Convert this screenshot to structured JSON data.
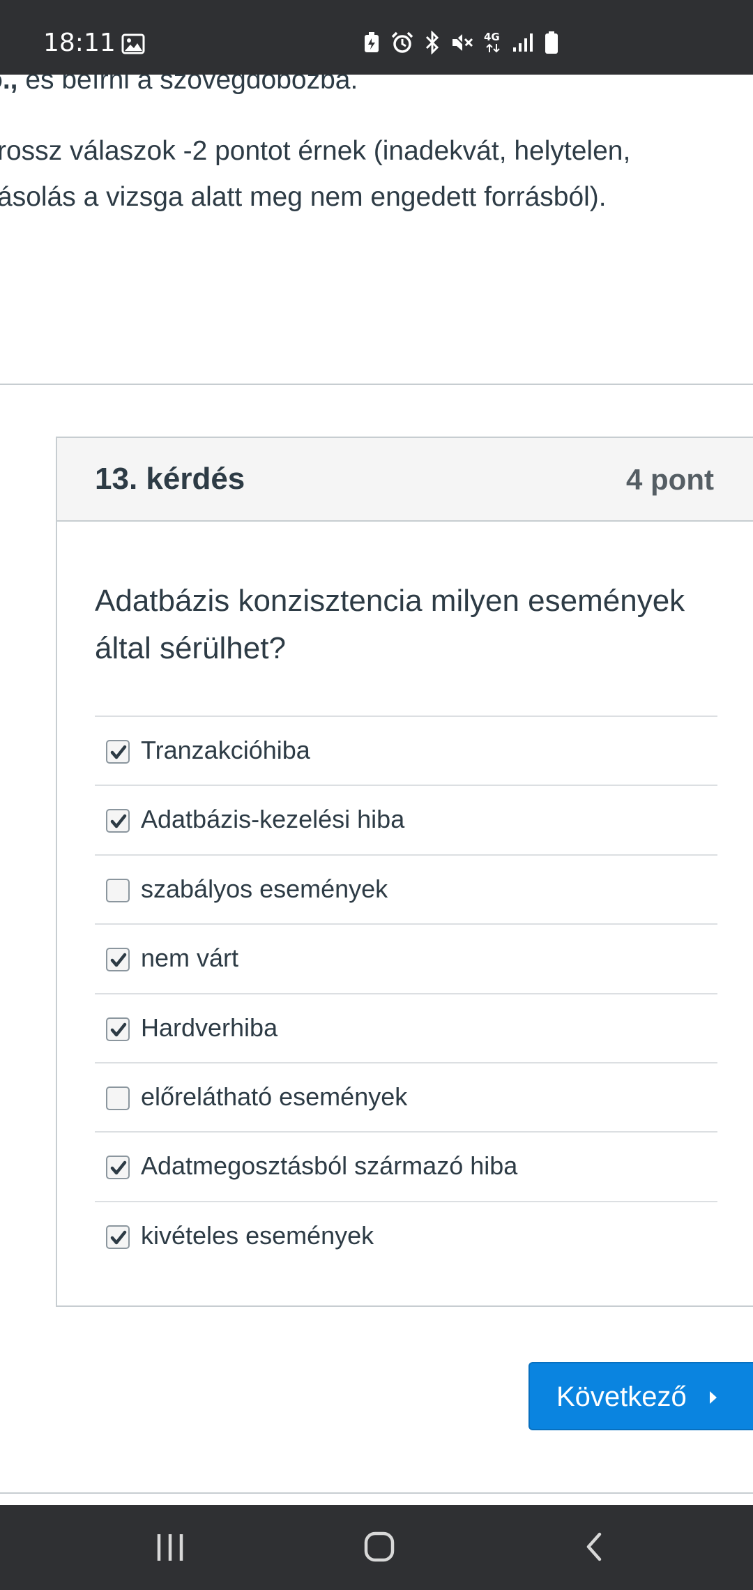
{
  "status_bar": {
    "time": "18:11",
    "network_label": "4G",
    "icons": [
      "image-icon",
      "battery-saver-icon",
      "alarm-icon",
      "bluetooth-icon",
      "mute-icon",
      "network-4g-icon",
      "signal-icon",
      "battery-icon"
    ]
  },
  "intro": {
    "cutoff_bold": "o.,",
    "cutoff_rest": " és beírni a szövegdobozba.",
    "line1": "rossz válaszok -2 pontot érnek (inadekvát, helytelen,",
    "line2": "ásolás a vizsga alatt meg nem engedett forrásból)."
  },
  "question": {
    "title": "13. kérdés",
    "points": "4 pont",
    "text": "Adatbázis konzisztencia milyen események által sérülhet?",
    "answers": [
      {
        "label": "Tranzakcióhiba",
        "checked": true
      },
      {
        "label": "Adatbázis-kezelési hiba",
        "checked": true
      },
      {
        "label": "szabályos események",
        "checked": false
      },
      {
        "label": "nem várt",
        "checked": true
      },
      {
        "label": "Hardverhiba",
        "checked": true
      },
      {
        "label": "előrelátható események",
        "checked": false
      },
      {
        "label": "Adatmegosztásból származó hiba",
        "checked": true
      },
      {
        "label": "kivételes események",
        "checked": true
      }
    ]
  },
  "next_button": {
    "label": "Következő",
    "icon": "caret-right-icon",
    "color": "#0a84e0"
  },
  "nav_bar": {
    "buttons": [
      "recents-icon",
      "home-icon",
      "back-icon"
    ]
  }
}
